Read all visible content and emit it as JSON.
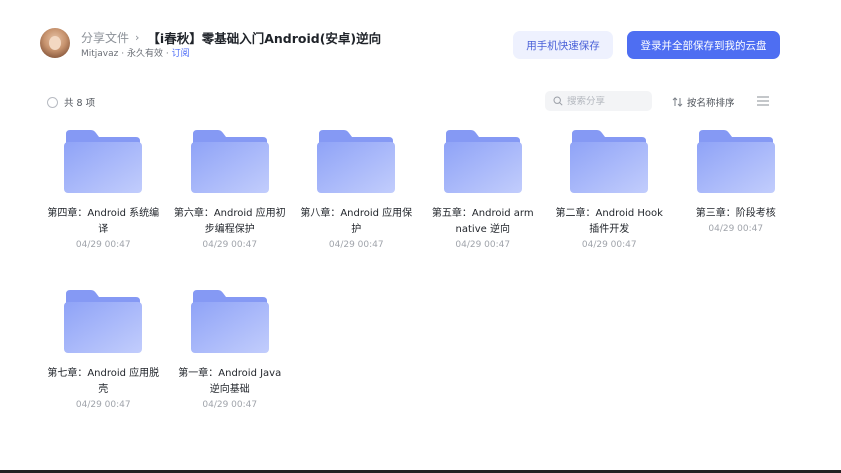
{
  "header": {
    "breadcrumb_root": "分享文件",
    "breadcrumb_sep": "›",
    "title": "【i春秋】零基础入门Android(安卓)逆向",
    "owner": "Mitjavaz",
    "validity": "永久有效",
    "subscribe": "订阅",
    "btn_phone": "用手机快速保存",
    "btn_save": "登录并全部保存到我的云盘"
  },
  "toolbar": {
    "count": "共 8 项",
    "search_placeholder": "搜索分享",
    "sort_label": "按名称排序"
  },
  "files": [
    {
      "name": "第四章：Android 系统编译",
      "date": "04/29 00:47"
    },
    {
      "name": "第六章：Android 应用初步编程保护",
      "date": "04/29 00:47"
    },
    {
      "name": "第八章：Android 应用保护",
      "date": "04/29 00:47"
    },
    {
      "name": "第五章：Android arm native 逆向",
      "date": "04/29 00:47"
    },
    {
      "name": "第二章：Android Hook 插件开发",
      "date": "04/29 00:47"
    },
    {
      "name": "第三章：阶段考核",
      "date": "04/29 00:47"
    },
    {
      "name": "第七章：Android 应用脱壳",
      "date": "04/29 00:47"
    },
    {
      "name": "第一章：Android Java 逆向基础",
      "date": "04/29 00:47"
    }
  ],
  "colors": {
    "accent": "#4e6ef2",
    "folder_top": "#8fa3f7",
    "folder_body": "#a8b8fb"
  },
  "icons": {
    "folder": "folder-icon",
    "search": "search-icon",
    "sort": "sort-icon",
    "menu": "list-menu-icon"
  }
}
